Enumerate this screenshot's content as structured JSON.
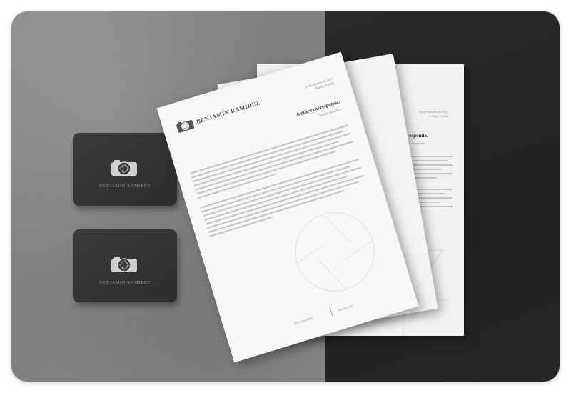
{
  "business_cards": [
    {
      "brand_name": "BENJAMIN RAMIREZ"
    },
    {
      "brand_name": "BENJAMIN RAMIREZ"
    }
  ],
  "letterhead": {
    "brand_name": "BENJAMIN RAMIREZ",
    "date": "20 de Octubre de 2017",
    "place": "Puebla, Puebla",
    "heading": "A quien corresponda.",
    "subheading": "Estudio fotográfico",
    "footer_left": "222-1234-5678",
    "footer_right": "ramirez.com"
  },
  "back_letter": {
    "date": "20 de Octubre de 2017",
    "place": "Puebla, Puebla",
    "heading": "ien corresponda.",
    "subheading": "Estudio fotográfico"
  }
}
